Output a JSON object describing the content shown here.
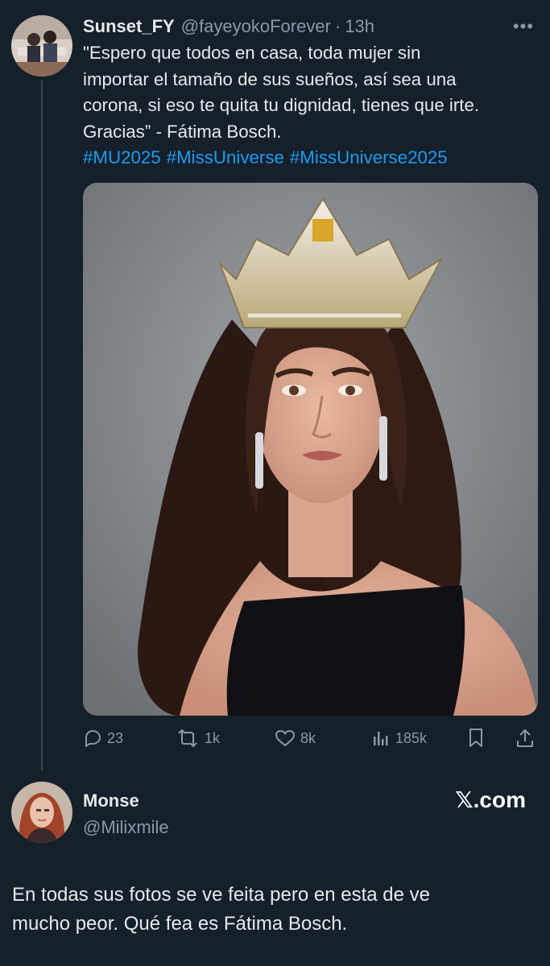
{
  "tweet": {
    "author_name": "Sunset_FY",
    "author_handle": "@fayeyokoForever",
    "separator": "·",
    "time": "13h",
    "more_label": "•••",
    "text_lines": [
      "\"Espero que todos en casa, toda mujer sin",
      "importar el tamaño de sus sueños, así sea una",
      "corona, si eso te quita tu dignidad, tienes que irte.",
      "Gracias” - Fátima Bosch."
    ],
    "hashtags": [
      "#MU2025",
      "#MissUniverse",
      "#MissUniverse2025"
    ],
    "media_icon": "photo-portrait",
    "stats": {
      "replies": "23",
      "reposts": "1k",
      "likes": "8k",
      "views": "185k"
    },
    "icons": [
      "reply-icon",
      "repost-icon",
      "like-icon",
      "views-icon",
      "bookmark-icon",
      "share-icon"
    ]
  },
  "reply": {
    "author_name": "Monse",
    "author_handle": "@Milixmile",
    "source_logo": "𝕏",
    "source_text": ".com",
    "text_lines": [
      "En todas sus fotos se ve feita pero en esta de ve",
      "mucho peor. Qué fea es Fátima Bosch."
    ]
  },
  "colors": {
    "background": "#15202b",
    "text": "#e7e9ea",
    "secondary": "#8b98a5",
    "link": "#1d9bf0",
    "thread_line": "#38444d"
  }
}
